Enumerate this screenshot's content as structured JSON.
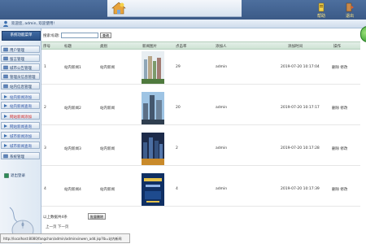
{
  "header": {
    "btn_help": "帮助",
    "btn_exit": "退出"
  },
  "subbar": {
    "welcome": "欢迎您, admin, 欢迎使用!"
  },
  "sidebar": {
    "title": "系统功能菜单",
    "items": [
      {
        "label": "用户管理",
        "style": "normal"
      },
      {
        "label": "留言管理",
        "style": "normal"
      },
      {
        "label": "城市公告管理",
        "style": "normal"
      },
      {
        "label": "管理员信息管理",
        "style": "normal"
      },
      {
        "label": "站内信息管理",
        "style": "normal"
      },
      {
        "label": "站内新闻添加",
        "style": "link"
      },
      {
        "label": "站内新闻查询",
        "style": "link"
      },
      {
        "label": "网站新闻添加",
        "style": "red"
      },
      {
        "label": "网站新闻查询",
        "style": "link"
      },
      {
        "label": "城市新闻添加",
        "style": "link"
      },
      {
        "label": "城市新闻查询",
        "style": "link"
      },
      {
        "label": "系统管理",
        "style": "normal"
      }
    ],
    "logout": "退出登录"
  },
  "search": {
    "prefix": "搜索:",
    "title_label": "标题:",
    "input_value": "",
    "button": "查询"
  },
  "table": {
    "headers": [
      "序号",
      "标题",
      "类别",
      "新闻图片",
      "点击率",
      "添加人",
      "添加时间",
      "操作"
    ],
    "rows": [
      {
        "no": "1",
        "title": "站内新闻1",
        "type": "站内新闻",
        "clicks": "29",
        "author": "admin",
        "time": "2019-07-20 10:17:04",
        "ops": "删除 修改"
      },
      {
        "no": "2",
        "title": "站内新闻2",
        "type": "站内新闻",
        "clicks": "20",
        "author": "admin",
        "time": "2019-07-20 10:17:17",
        "ops": "删除 修改"
      },
      {
        "no": "3",
        "title": "站内新闻3",
        "type": "站内新闻",
        "clicks": "2",
        "author": "admin",
        "time": "2019-07-20 10:17:28",
        "ops": "删除 修改"
      },
      {
        "no": "4",
        "title": "站内新闻4",
        "type": "站内新闻",
        "clicks": "4",
        "author": "admin",
        "time": "2019-07-20 10:17:39",
        "ops": "删除 修改"
      }
    ]
  },
  "footer": {
    "label": "以上数据共4条",
    "delete_button": "批量删除",
    "pager": "上一页 下一页"
  },
  "statusbar": {
    "url": "http://localhost:8080/fangchan/admin/adminxinwen_add.jsp?lb=站内新闻"
  },
  "colors": {
    "header": "#3b5a87",
    "accent_red": "#d22a2a",
    "link_blue": "#2c55a8"
  }
}
